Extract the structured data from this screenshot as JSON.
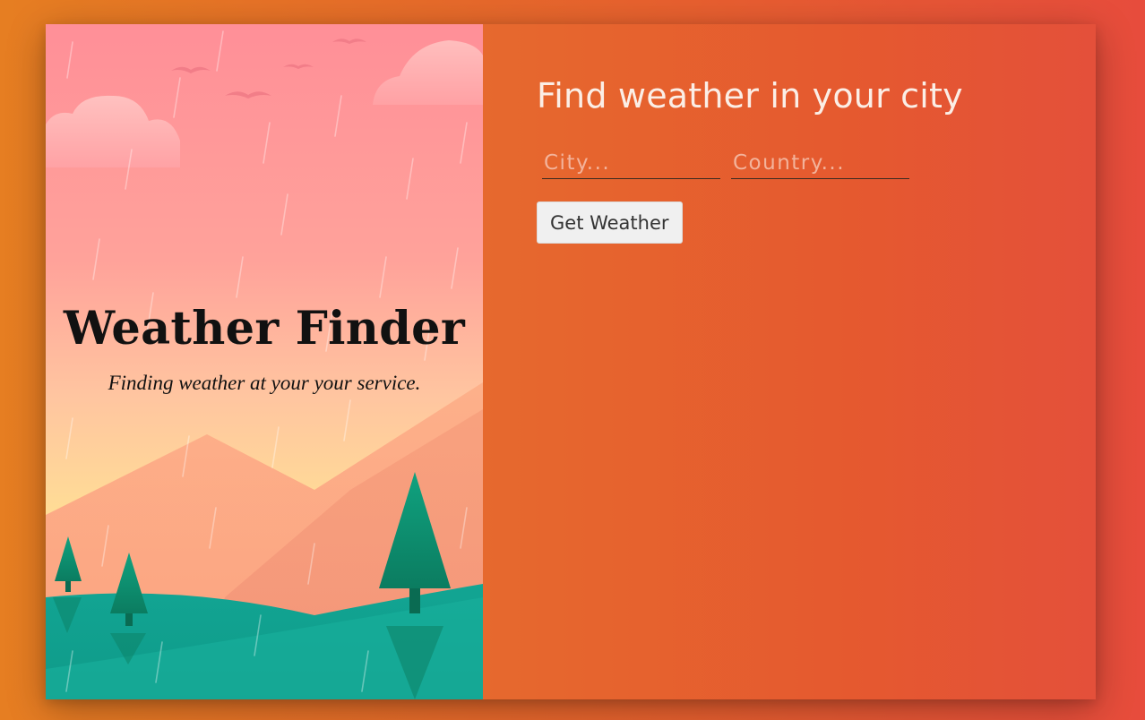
{
  "hero": {
    "title": "Weather Finder",
    "subtitle": "Finding weather at your your service."
  },
  "form": {
    "heading": "Find weather in your city",
    "city_placeholder": "City...",
    "country_placeholder": "Country...",
    "city_value": "",
    "country_value": "",
    "submit_label": "Get Weather"
  },
  "colors": {
    "page_bg_start": "#e67e22",
    "page_bg_end": "#e74c3c",
    "sky_top": "#ff8f98",
    "sky_horizon": "#ffd98f",
    "trees": "#0f8a6e",
    "hills": "#14a394",
    "button_bg": "#f0f0f0"
  }
}
